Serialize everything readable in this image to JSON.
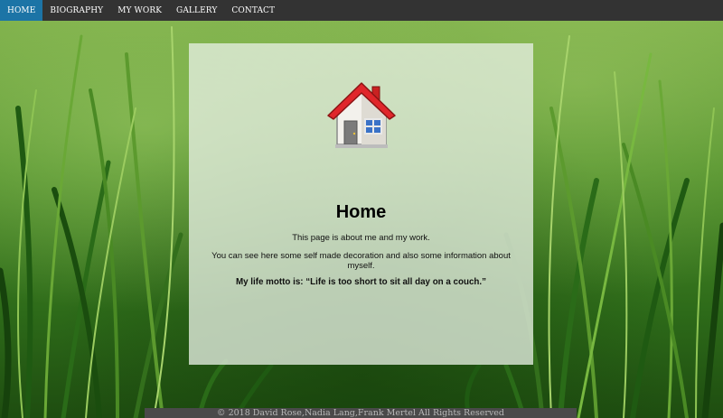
{
  "nav": {
    "items": [
      {
        "label": "HOME",
        "active": true
      },
      {
        "label": "BIOGRAPHY",
        "active": false
      },
      {
        "label": "MY WORK",
        "active": false
      },
      {
        "label": "GALLERY",
        "active": false
      },
      {
        "label": "CONTACT",
        "active": false
      }
    ]
  },
  "main": {
    "icon": "house-icon",
    "title": "Home",
    "paragraph1": "This page is about me and my work.",
    "paragraph2": "You can see here some self made decoration and also some information about myself.",
    "motto": "My life motto is: “Life is too short to sit all day on a couch.”"
  },
  "footer": {
    "text": "© 2018 David Rose,Nadia Lang,Frank Mertel All Rights Reserved"
  },
  "colors": {
    "nav_bg": "#333333",
    "nav_active": "#1c74a6",
    "footer_bg": "#4a4a4a"
  }
}
